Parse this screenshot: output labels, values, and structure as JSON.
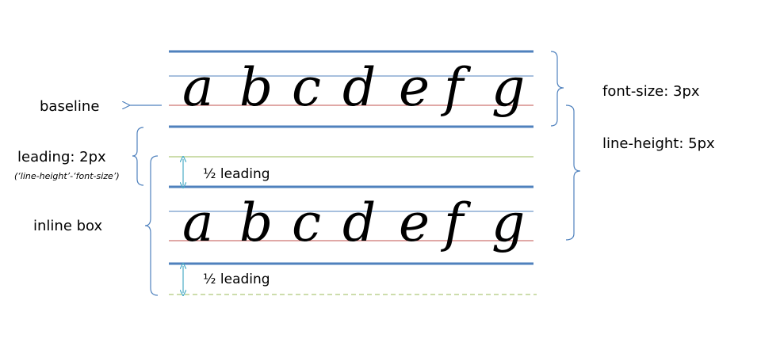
{
  "letters": [
    "a",
    "b",
    "c",
    "d",
    "e",
    "f",
    "g"
  ],
  "labels": {
    "baseline": "baseline",
    "leading": "leading: 2px",
    "leading_formula": "(‘line-height’-‘font-size’)",
    "inline_box": "inline box",
    "half_leading_top": "½ leading",
    "half_leading_bottom": "½ leading",
    "font_size": "font-size:  3px",
    "line_height": "line-height: 5px"
  },
  "colors": {
    "em_box_line": "#4f81bd",
    "baseline_line": "#c0504d",
    "leading_line": "#9bbb59",
    "guide_line": "#4f81bd",
    "arrow_teal": "#4bacc6",
    "bracket": "#4f81bd"
  }
}
